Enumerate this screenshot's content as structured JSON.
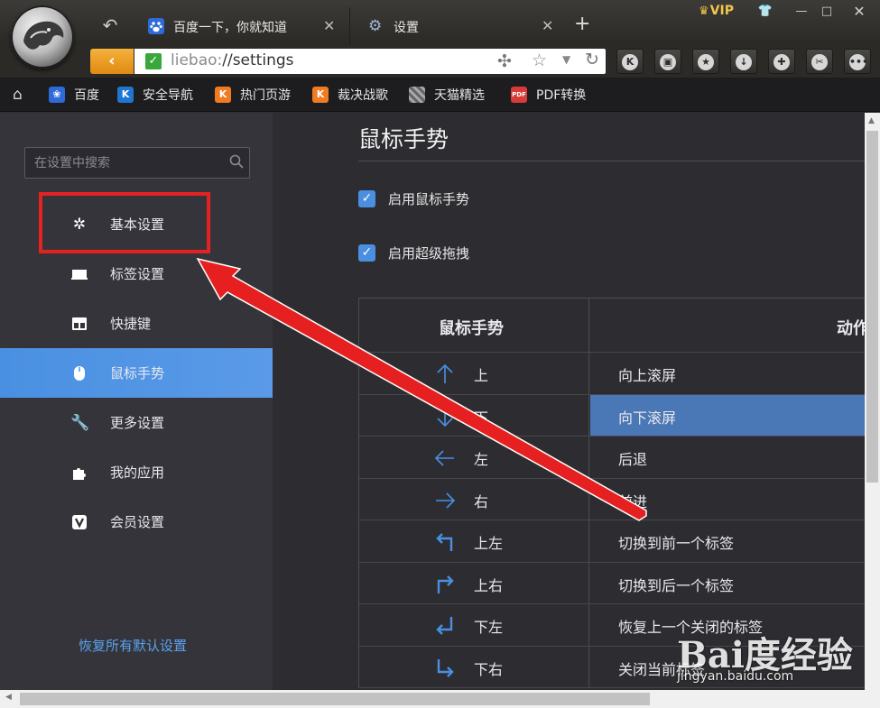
{
  "tabs": [
    {
      "label": "百度一下，你就知道",
      "icon": "baidu-paw-icon"
    },
    {
      "label": "设置",
      "icon": "gear-icon"
    }
  ],
  "vip_label": "VIP",
  "address": {
    "scheme": "liebao:",
    "path": "//settings"
  },
  "bookmarks": [
    {
      "label": "百度",
      "icon": "baidu-paw-icon",
      "color": "#2e6ad8"
    },
    {
      "label": "安全导航",
      "icon": "k-logo-icon",
      "color": "#1f76d0"
    },
    {
      "label": "热门页游",
      "icon": "k-logo-icon",
      "color": "#f07b21"
    },
    {
      "label": "裁决战歌",
      "icon": "k-logo-icon",
      "color": "#f07b21"
    },
    {
      "label": "天猫精选",
      "icon": "tmall-icon"
    },
    {
      "label": "PDF转换",
      "icon": "pdf-icon",
      "color": "#d93a3a",
      "icon_text": "PDF"
    }
  ],
  "sidebar": {
    "search_placeholder": "在设置中搜索",
    "items": [
      {
        "label": "基本设置",
        "icon": "gear-icon"
      },
      {
        "label": "标签设置",
        "icon": "tab-icon"
      },
      {
        "label": "快捷键",
        "icon": "keyboard-layout-icon"
      },
      {
        "label": "鼠标手势",
        "icon": "mouse-icon",
        "active": true
      },
      {
        "label": "更多设置",
        "icon": "wrench-icon"
      },
      {
        "label": "我的应用",
        "icon": "puzzle-icon"
      },
      {
        "label": "会员设置",
        "icon": "vip-v-icon"
      }
    ],
    "restore_label": "恢复所有默认设置"
  },
  "main": {
    "title": "鼠标手势",
    "options": [
      {
        "label": "启用鼠标手势",
        "checked": true
      },
      {
        "label": "启用超级拖拽",
        "checked": true
      }
    ],
    "table": {
      "headers": {
        "gesture": "鼠标手势",
        "action": "动作"
      },
      "rows": [
        {
          "direction": "上",
          "icon": "arrow-up-icon",
          "action": "向上滚屏"
        },
        {
          "direction": "下",
          "icon": "arrow-down-icon",
          "action": "向下滚屏",
          "selected": true
        },
        {
          "direction": "左",
          "icon": "arrow-left-icon",
          "action": "后退"
        },
        {
          "direction": "右",
          "icon": "arrow-right-icon",
          "action": "前进"
        },
        {
          "direction": "上左",
          "icon": "arrow-up-left-icon",
          "action": "切换到前一个标签"
        },
        {
          "direction": "上右",
          "icon": "arrow-up-right-icon",
          "action": "切换到后一个标签"
        },
        {
          "direction": "下左",
          "icon": "arrow-down-left-icon",
          "action": "恢复上一个关闭的标签"
        },
        {
          "direction": "下右",
          "icon": "arrow-down-right-icon",
          "action": "关闭当前标签"
        }
      ]
    }
  },
  "watermark": {
    "brand": "Bai度经验",
    "url": "jingyan.baidu.com"
  },
  "colors": {
    "accent": "#4a90e2",
    "highlight": "#e52222",
    "selected_row": "#4a77b5"
  }
}
